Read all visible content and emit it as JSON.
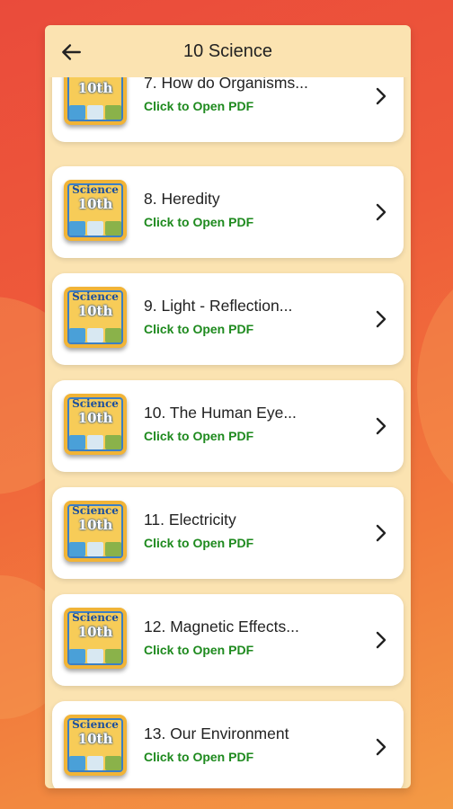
{
  "header": {
    "title": "10 Science"
  },
  "thumbnail": {
    "line1": "Science",
    "line2": "10th"
  },
  "chapters": [
    {
      "title": "7. How do Organisms...",
      "subtitle": "Click to Open PDF"
    },
    {
      "title": "8. Heredity",
      "subtitle": "Click to Open PDF"
    },
    {
      "title": "9. Light - Reflection...",
      "subtitle": "Click to Open PDF"
    },
    {
      "title": "10. The Human Eye...",
      "subtitle": "Click to Open PDF"
    },
    {
      "title": "11. Electricity",
      "subtitle": "Click to Open PDF"
    },
    {
      "title": "12. Magnetic Effects...",
      "subtitle": "Click to Open PDF"
    },
    {
      "title": "13. Our Environment",
      "subtitle": "Click to Open PDF"
    }
  ],
  "icons": {
    "back": "arrow-left-icon",
    "open": "chevron-right-icon"
  },
  "colors": {
    "panel": "#fbe3b1",
    "link": "#1e8a1e",
    "background": "#ee5a3a"
  }
}
